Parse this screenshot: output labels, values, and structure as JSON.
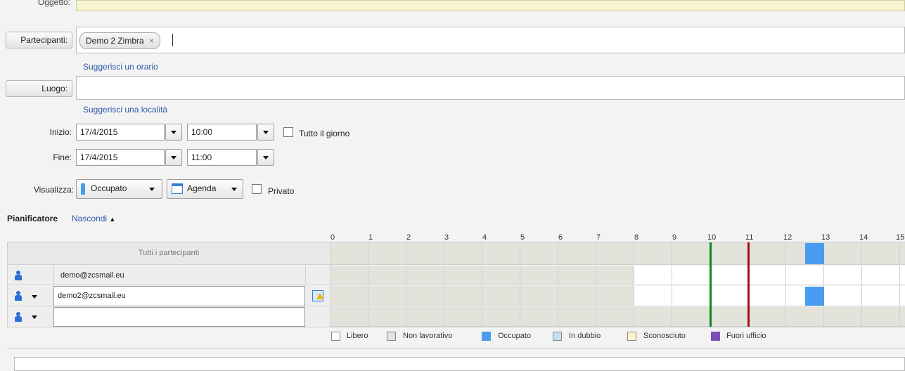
{
  "form": {
    "subject_label": "Oggetto:",
    "participants_button": "Partecipanti:",
    "participant_chip": "Demo 2 Zimbra",
    "suggest_time": "Suggerisci un orario",
    "location_button": "Luogo:",
    "suggest_location": "Suggerisci una località",
    "start_label": "Inizio:",
    "start_date": "17/4/2015",
    "start_time": "10:00",
    "all_day_label": "Tutto il giorno",
    "end_label": "Fine:",
    "end_date": "17/4/2015",
    "end_time": "11:00",
    "show_label": "Visualizza:",
    "show_value": "Occupato",
    "calendar_value": "Agenda",
    "private_label": "Privato"
  },
  "scheduler": {
    "title": "Pianificatore",
    "hide_link": "Nascondi",
    "hours": [
      "0",
      "1",
      "2",
      "3",
      "4",
      "5",
      "6",
      "7",
      "8",
      "9",
      "10",
      "11",
      "12",
      "13",
      "14",
      "15"
    ],
    "all_attendees": "Tutti i partecipanti",
    "rows": [
      {
        "email": "demo@zcsmail.eu"
      },
      {
        "email": "demo2@zcsmail.eu"
      },
      {
        "email": ""
      }
    ],
    "legend": [
      "Libero",
      "Non lavorativo",
      "Occupato",
      "In dubbio",
      "Sconosciuto",
      "Fuori ufficio"
    ],
    "colors": {
      "free": "#ffffff",
      "non_working": "#e3e3dc",
      "busy": "#4a9cf0",
      "tentative": "#bfe3ee",
      "unknown": "#fdf2cf",
      "out_of_office": "#7b4fb5",
      "start_line": "#0a8a1c",
      "end_line": "#a11212"
    }
  }
}
